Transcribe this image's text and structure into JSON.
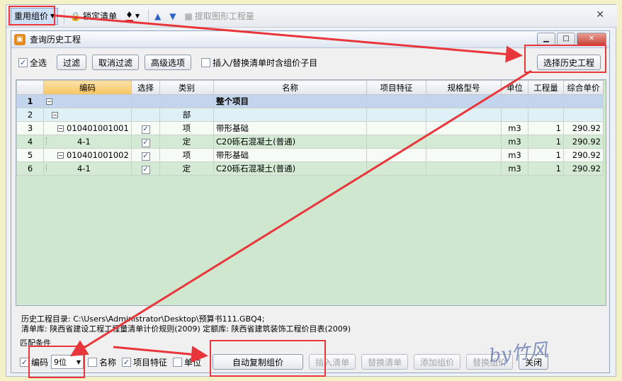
{
  "toolbar": {
    "reuse_label": "重用组价",
    "lock_label": "锁定清单",
    "extract_label": "提取图形工程量"
  },
  "dialog": {
    "title": "查询历史工程",
    "select_all_label": "全选",
    "filter_label": "过滤",
    "cancel_filter_label": "取消过滤",
    "advanced_label": "高级选项",
    "include_sub_label": "插入/替换清单时含组价子目",
    "select_history_label": "选择历史工程"
  },
  "table": {
    "headers": [
      "编码",
      "选择",
      "类别",
      "名称",
      "项目特征",
      "规格型号",
      "单位",
      "工程量",
      "综合单价"
    ],
    "rows": [
      {
        "num": "1",
        "code": "",
        "chk": "",
        "type": "",
        "name": "整个项目",
        "feat": "",
        "spec": "",
        "unit": "",
        "qty": "",
        "price": ""
      },
      {
        "num": "2",
        "code": "",
        "chk": "",
        "type": "部",
        "name": "",
        "feat": "",
        "spec": "",
        "unit": "",
        "qty": "",
        "price": ""
      },
      {
        "num": "3",
        "code": "010401001001",
        "chk": "✓",
        "type": "项",
        "name": "带形基础",
        "feat": "",
        "spec": "",
        "unit": "m3",
        "qty": "1",
        "price": "290.92"
      },
      {
        "num": "4",
        "code": "4-1",
        "chk": "✓",
        "type": "定",
        "name": "C20砾石混凝土(普通)",
        "feat": "",
        "spec": "",
        "unit": "m3",
        "qty": "1",
        "price": "290.92"
      },
      {
        "num": "5",
        "code": "010401001002",
        "chk": "✓",
        "type": "项",
        "name": "带形基础",
        "feat": "",
        "spec": "",
        "unit": "m3",
        "qty": "1",
        "price": "290.92"
      },
      {
        "num": "6",
        "code": "4-1",
        "chk": "✓",
        "type": "定",
        "name": "C20砾石混凝土(普通)",
        "feat": "",
        "spec": "",
        "unit": "m3",
        "qty": "1",
        "price": "290.92"
      }
    ]
  },
  "info": {
    "history_dir": "历史工程目录: C:\\Users\\Administrator\\Desktop\\预算书111.GBQ4;",
    "libraries": "清单库: 陕西省建设工程工程量清单计价规则(2009) 定额库: 陕西省建筑装饰工程价目表(2009)"
  },
  "match": {
    "title": "匹配条件",
    "code_label": "编码",
    "digits_value": "9位",
    "name_label": "名称",
    "feature_label": "项目特征",
    "unit_label": "单位"
  },
  "buttons": {
    "auto_copy": "自动复制组价",
    "insert_list": "插入清单",
    "replace_list": "替换清单",
    "add_price": "添加组价",
    "replace_price": "替换组价",
    "close": "关闭"
  },
  "watermark": "by竹风"
}
